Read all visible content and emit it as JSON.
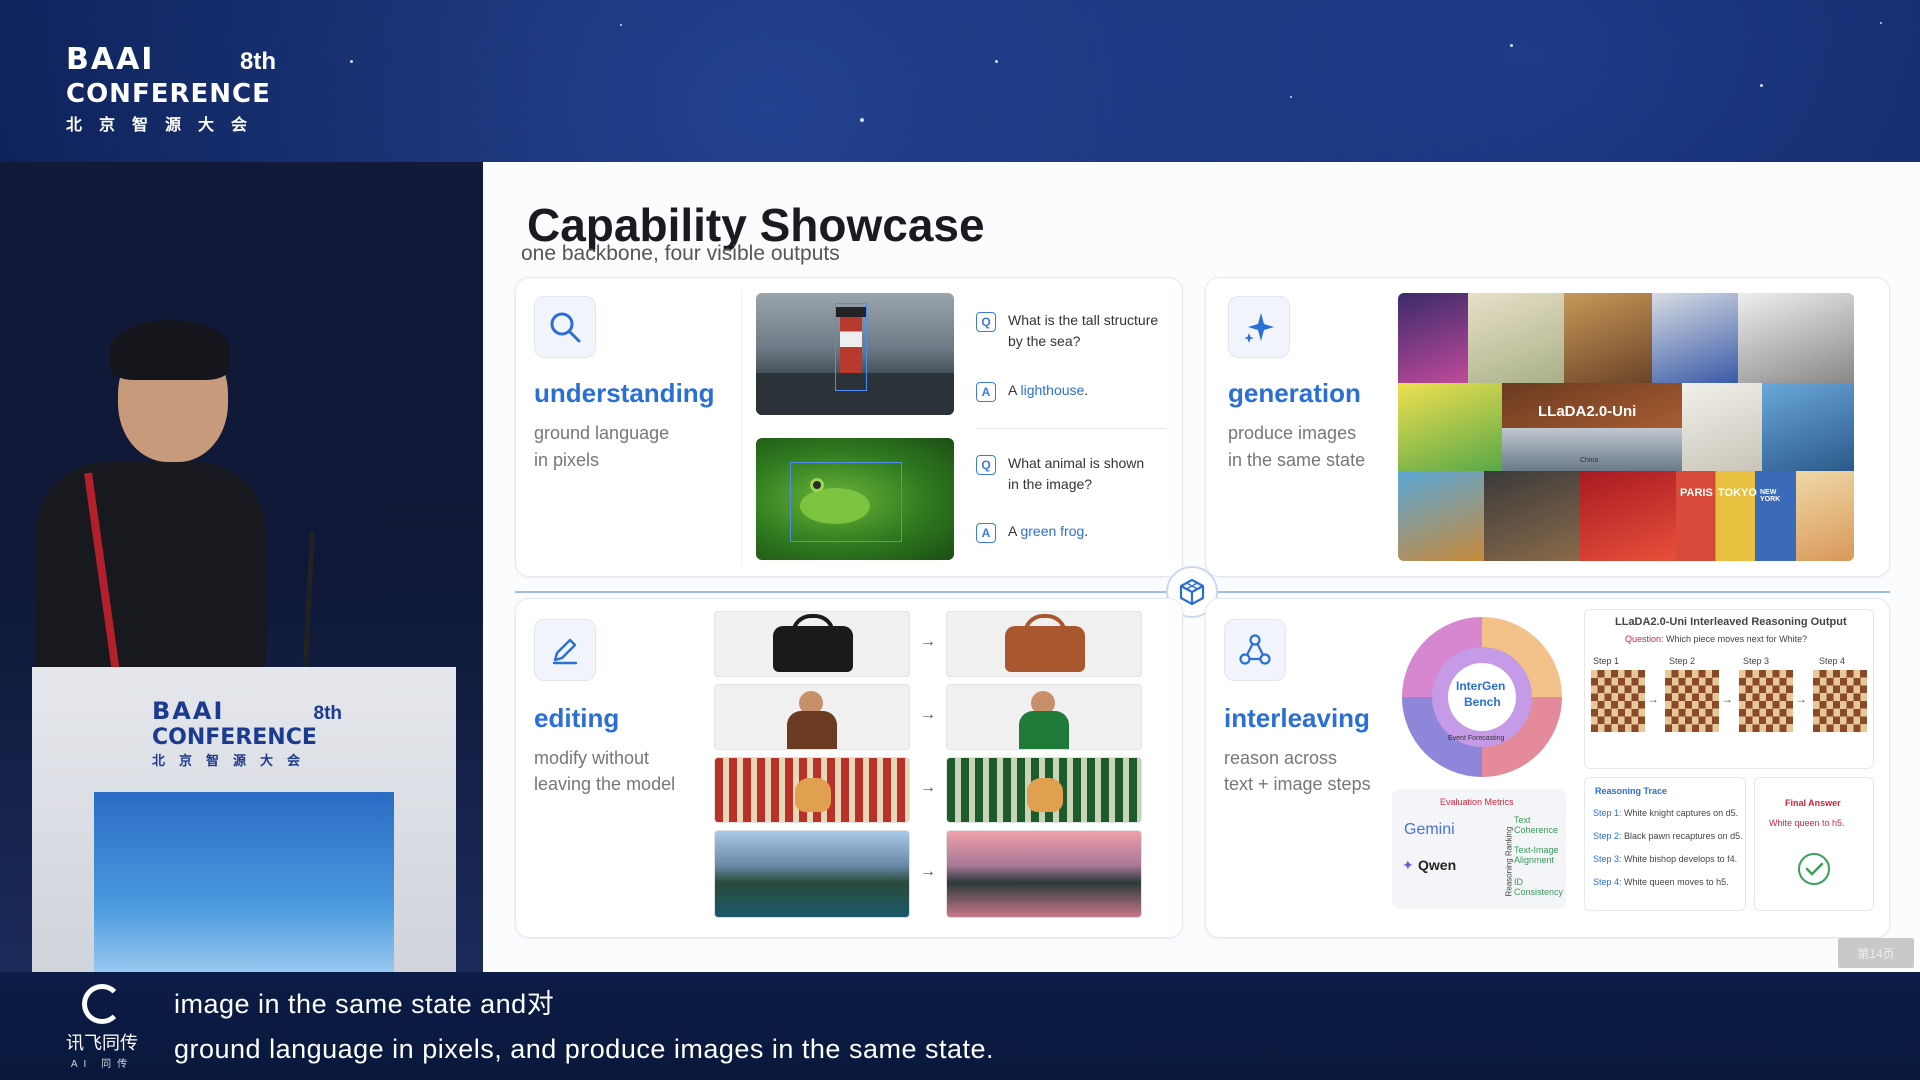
{
  "event": {
    "brand": "BAAI",
    "edition": "8th",
    "name": "CONFERENCE",
    "name_cn": "北京智源大会"
  },
  "slide": {
    "title": "Capability Showcase",
    "subtitle": "one backbone, four visible outputs",
    "page_label": "第14页",
    "understanding": {
      "title": "understanding",
      "desc_line1": "ground language",
      "desc_line2": "in pixels",
      "qa": [
        {
          "q_badge": "Q",
          "q_line1": "What is the tall structure",
          "q_line2": "by the sea?",
          "a_badge": "A",
          "a_prefix": "A ",
          "a_answer": "lighthouse",
          "a_suffix": "."
        },
        {
          "q_badge": "Q",
          "q_line1": "What animal is shown",
          "q_line2": "in the image?",
          "a_badge": "A",
          "a_prefix": "A ",
          "a_answer": "green frog",
          "a_suffix": "."
        }
      ]
    },
    "generation": {
      "title": "generation",
      "desc_line1": "produce images",
      "desc_line2": "in the same state",
      "collage_labels": [
        "LLaDA2.0-Uni",
        "PARIS",
        "TOKYO",
        "NEW YORK",
        "China"
      ]
    },
    "editing": {
      "title": "editing",
      "desc_line1": "modify without",
      "desc_line2": "leaving the model",
      "arrow": "→"
    },
    "interleaving": {
      "title": "interleaving",
      "desc_line1": "reason across",
      "desc_line2": "text + image steps",
      "bench_label_1": "InterGen",
      "bench_label_2": "Bench",
      "bench_ring": "Event Forecasting",
      "eval_title": "Evaluation Metrics",
      "eval_models": [
        "Gemini",
        "Qwen"
      ],
      "eval_side": "Reasoning Ranking",
      "eval_metrics": [
        "Text Coherence",
        "Text-Image Alignment",
        "ID Consistency"
      ],
      "output_title": "LLaDA2.0-Uni Interleaved Reasoning Output",
      "question_label": "Question:",
      "question": "Which piece moves next for White?",
      "steps": [
        "Step 1",
        "Step 2",
        "Step 3",
        "Step 4"
      ],
      "trace_title": "Reasoning Trace",
      "trace": [
        {
          "label": "Step 1:",
          "text": "White knight captures on d5."
        },
        {
          "label": "Step 2:",
          "text": "Black pawn recaptures on d5."
        },
        {
          "label": "Step 3:",
          "text": "White bishop develops to f4."
        },
        {
          "label": "Step 4:",
          "text": "White queen moves to h5."
        }
      ],
      "final_title": "Final Answer",
      "final_text": "White queen to h5."
    }
  },
  "captions": {
    "brand": "讯飞同传",
    "brand_sub": "AI 同传",
    "line1": "image in the same state and对",
    "line2": "ground language in pixels, and produce images in the same state."
  },
  "colors": {
    "accent": "#2a6fd6",
    "stage_bg": "#0b1a44",
    "answer_red": "#d0243a"
  }
}
